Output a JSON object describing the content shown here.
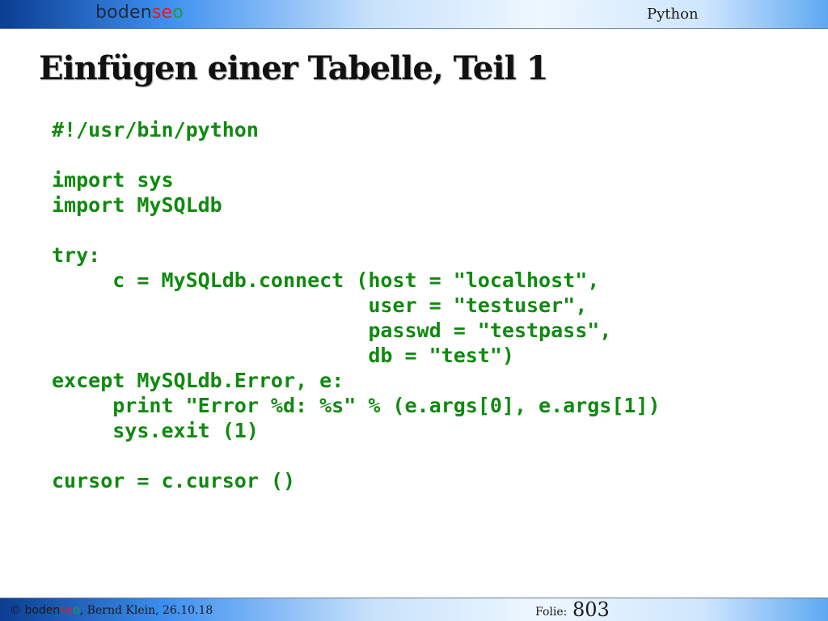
{
  "header": {
    "logo": {
      "part1": "boden",
      "part2": "se",
      "part3": "o"
    },
    "topic": "Python"
  },
  "slide": {
    "title": "Einfügen einer Tabelle, Teil 1",
    "code_lines": [
      "#!/usr/bin/python",
      "",
      "import sys",
      "import MySQLdb",
      "",
      "try:",
      "     c = MySQLdb.connect (host = \"localhost\",",
      "                          user = \"testuser\",",
      "                          passwd = \"testpass\",",
      "                          db = \"test\")",
      "except MySQLdb.Error, e:",
      "     print \"Error %d: %s\" % (e.args[0], e.args[1])",
      "     sys.exit (1)",
      "",
      "cursor = c.cursor ()"
    ]
  },
  "footer": {
    "copyright": "©",
    "brand": {
      "part1": "boden",
      "part2": "se",
      "part3": "o"
    },
    "author_date": ", Bernd Klein, 26.10.18",
    "folie_label": "Folie:",
    "folie_number": "803"
  },
  "colors": {
    "code": "#0f8a0f",
    "brand_red": "#d2232a",
    "brand_green": "#1a9b4a",
    "bar_blue": "#3c8ff0"
  }
}
